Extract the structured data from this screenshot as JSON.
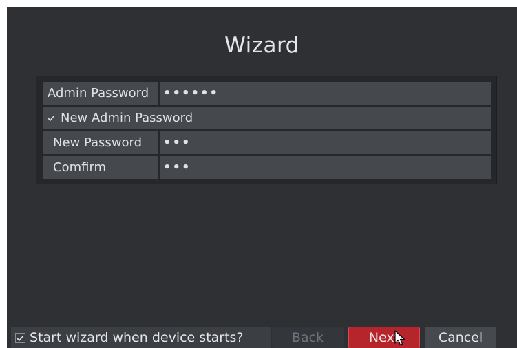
{
  "dialog": {
    "title": "Wizard"
  },
  "form": {
    "admin_password_label": "Admin Password",
    "admin_password_value": "••••••",
    "new_admin_password_label": "New Admin Password",
    "new_password_label": "New Password",
    "new_password_value": "•••",
    "confirm_label": "Comfirm",
    "confirm_value": "•••"
  },
  "footer": {
    "start_wizard_label": "Start wizard when device starts?",
    "back_label": "Back",
    "next_label": "Next",
    "cancel_label": "Cancel"
  },
  "icons": {
    "checkbox": "checkmark-icon",
    "pointer": "mouse-cursor-icon"
  },
  "colors": {
    "background": "#2e3034",
    "field": "#45484c",
    "accent": "#b7252c"
  }
}
